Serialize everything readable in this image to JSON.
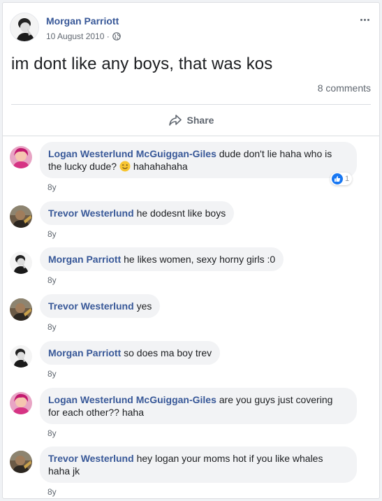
{
  "post": {
    "author": "Morgan Parriott",
    "date": "10 August 2010 ·",
    "privacy_icon": "globe-icon",
    "text": "im dont like any boys, that was kos",
    "comment_count": "8 comments",
    "share_label": "Share",
    "more_icon": "more-options-icon"
  },
  "comments": [
    {
      "author": "Logan Westerlund McGuiggan-Giles",
      "text_line1": "dude don't lie haha who is",
      "text_line2": "the lucky dude?",
      "text_line2_after": "hahahahaha",
      "emoji": "wink-emoji",
      "time": "8y",
      "reaction_count": "1",
      "reaction_icon": "like-icon",
      "avatar": "pink-avatar"
    },
    {
      "author": "Trevor Westerlund",
      "text": "he dodesnt like boys",
      "time": "8y",
      "avatar": "dark-avatar"
    },
    {
      "author": "Morgan Parriott",
      "text": "he likes women, sexy horny girls :0",
      "time": "8y",
      "avatar": "bw-avatar"
    },
    {
      "author": "Trevor Westerlund",
      "text": "yes",
      "time": "8y",
      "avatar": "dark-avatar"
    },
    {
      "author": "Morgan Parriott",
      "text": "so does ma boy trev",
      "time": "8y",
      "avatar": "bw-avatar"
    },
    {
      "author": "Logan Westerlund McGuiggan-Giles",
      "text_line1": "are you guys just covering",
      "text_line2": "for each other?? haha",
      "time": "8y",
      "avatar": "pink-avatar"
    },
    {
      "author": "Trevor Westerlund",
      "text_line1": "hey logan your moms hot if you like whales",
      "text_line2": "haha jk",
      "time": "8y",
      "avatar": "dark-avatar"
    }
  ],
  "colors": {
    "author_link": "#385898",
    "bubble_bg": "#f2f3f5",
    "meta_text": "#606770",
    "like_blue": "#1877f2"
  }
}
